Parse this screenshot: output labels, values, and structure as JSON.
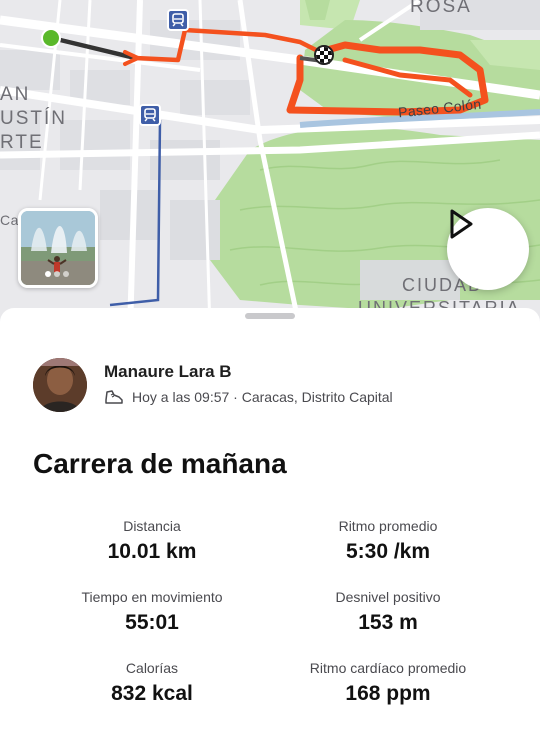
{
  "map": {
    "labels": {
      "rosa": "ROSA",
      "an": "AN",
      "ustin": "USTÍN",
      "rte": "RTE",
      "cab_stin": "Cab  stín",
      "ciudad": "CIUDAD",
      "universitaria": "UNIVERSITARIA"
    },
    "street_label": "Paseo Colón",
    "colors": {
      "route": "#f4511e",
      "route_dark": "#333333",
      "park": "#b6dc9e",
      "road": "#ffffff",
      "transit": "#3f5ea8",
      "start": "#59b82a"
    }
  },
  "photo": {
    "icon": "photo-thumbnail"
  },
  "play": {
    "icon": "play-icon"
  },
  "activity": {
    "athlete_name": "Manaure Lara B",
    "meta_icon": "running-shoe-icon",
    "meta_text": "Hoy a las 09:57 · Caracas, Distrito Capital",
    "title": "Carrera de mañana"
  },
  "stats": {
    "distance": {
      "label": "Distancia",
      "value": "10.01 km"
    },
    "pace": {
      "label": "Ritmo promedio",
      "value": "5:30 /km"
    },
    "moving_time": {
      "label": "Tiempo en movimiento",
      "value": "55:01"
    },
    "elevation": {
      "label": "Desnivel positivo",
      "value": "153 m"
    },
    "calories": {
      "label": "Calorías",
      "value": "832 kcal"
    },
    "heart_rate": {
      "label": "Ritmo cardíaco promedio",
      "value": "168 ppm"
    }
  }
}
